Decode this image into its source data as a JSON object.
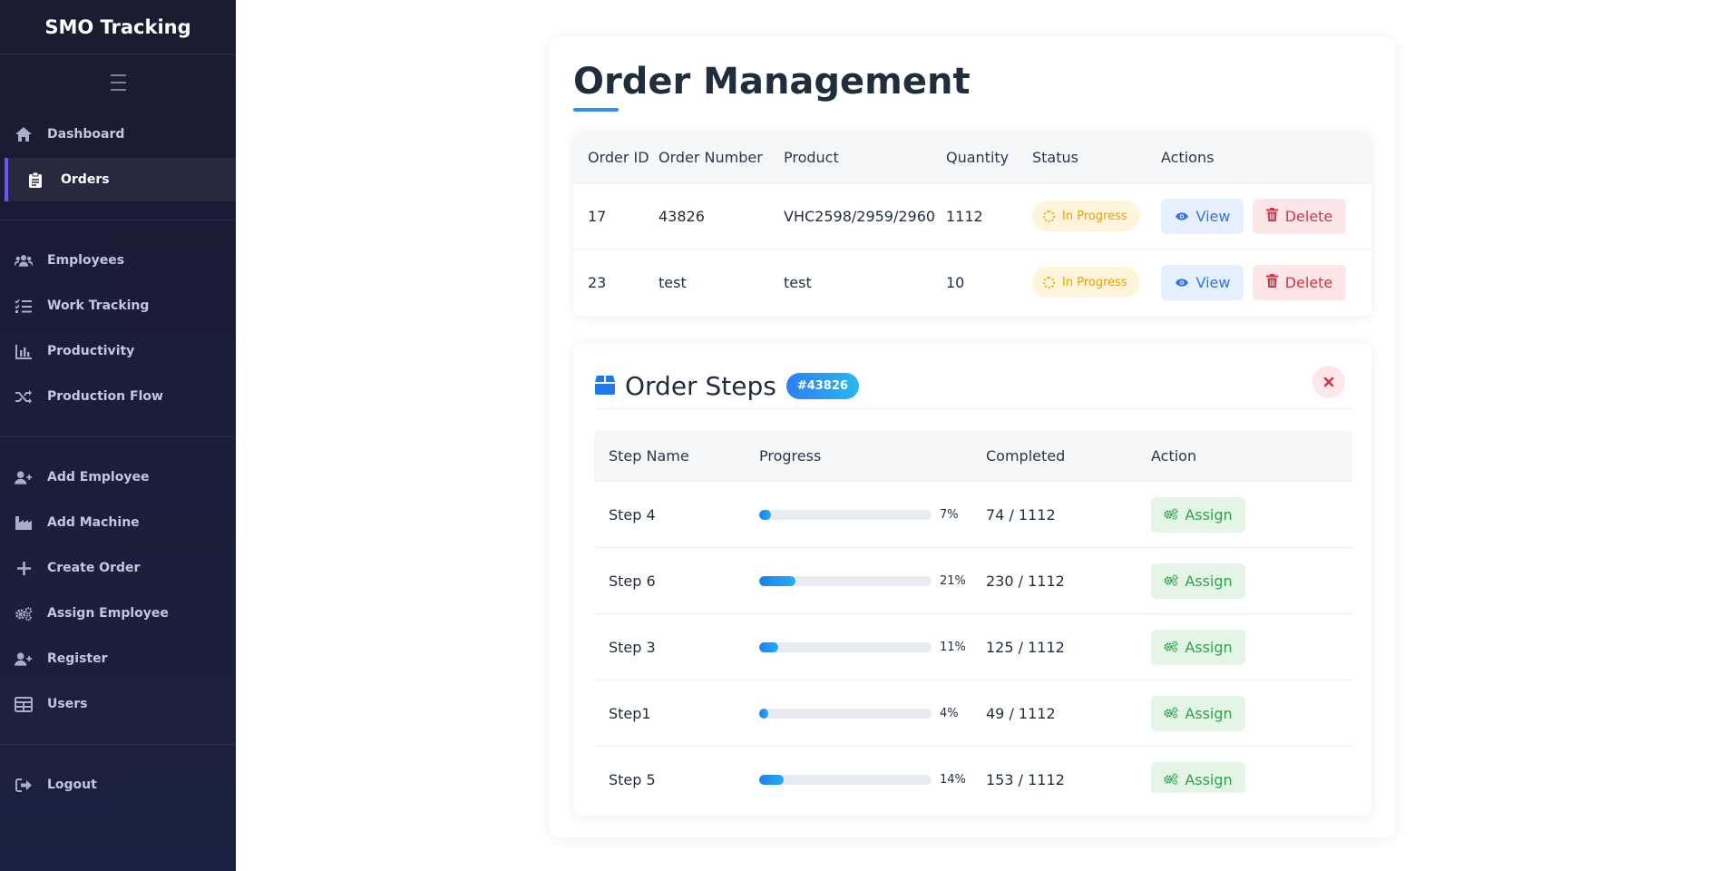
{
  "app": {
    "title": "SMO Tracking"
  },
  "sidebar": {
    "groups": [
      [
        {
          "label": "Dashboard",
          "icon": "home-icon",
          "active": false
        },
        {
          "label": "Orders",
          "icon": "clipboard-icon",
          "active": true
        }
      ],
      [
        {
          "label": "Employees",
          "icon": "users-icon",
          "active": false
        },
        {
          "label": "Work Tracking",
          "icon": "tasks-icon",
          "active": false
        },
        {
          "label": "Productivity",
          "icon": "bar-chart-icon",
          "active": false
        },
        {
          "label": "Production Flow",
          "icon": "shuffle-icon",
          "active": false
        }
      ],
      [
        {
          "label": "Add Employee",
          "icon": "user-plus-icon",
          "active": false
        },
        {
          "label": "Add Machine",
          "icon": "industry-icon",
          "active": false
        },
        {
          "label": "Create Order",
          "icon": "plus-icon",
          "active": false
        },
        {
          "label": "Assign Employee",
          "icon": "cogs-icon",
          "active": false
        },
        {
          "label": "Register",
          "icon": "user-plus-icon",
          "active": false
        },
        {
          "label": "Users",
          "icon": "table-icon",
          "active": false
        }
      ],
      [
        {
          "label": "Logout",
          "icon": "sign-out-icon",
          "active": false
        }
      ]
    ]
  },
  "page": {
    "title": "Order Management",
    "orders_table": {
      "columns": [
        "Order ID",
        "Order Number",
        "Product",
        "Quantity",
        "Status",
        "Actions"
      ],
      "rows": [
        {
          "id": "17",
          "number": "43826",
          "product": "VHC2598/2959/2960",
          "quantity": "1112",
          "status": "In Progress"
        },
        {
          "id": "23",
          "number": "test",
          "product": "test",
          "quantity": "10",
          "status": "In Progress"
        }
      ],
      "view_label": "View",
      "delete_label": "Delete"
    },
    "steps": {
      "title": "Order Steps",
      "order_badge": "#43826",
      "columns": [
        "Step Name",
        "Progress",
        "Completed",
        "Action"
      ],
      "assign_label": "Assign",
      "rows": [
        {
          "name": "Step 4",
          "progress": 0.07,
          "pct_label": "7%",
          "completed": "74 / 1112"
        },
        {
          "name": "Step 6",
          "progress": 0.21,
          "pct_label": "21%",
          "completed": "230 / 1112"
        },
        {
          "name": "Step 3",
          "progress": 0.11,
          "pct_label": "11%",
          "completed": "125 / 1112"
        },
        {
          "name": "Step1",
          "progress": 0.04,
          "pct_label": "4%",
          "completed": "49 / 1112"
        },
        {
          "name": "Step 5",
          "progress": 0.14,
          "pct_label": "14%",
          "completed": "153 / 1112"
        }
      ]
    }
  },
  "colors": {
    "sidebar_bg": "#1b1b31",
    "accent": "#6a55f5",
    "primary": "#2e8ff0",
    "status_in_progress": "#e6a100",
    "delete": "#d63447",
    "assign": "#2fa14a"
  }
}
